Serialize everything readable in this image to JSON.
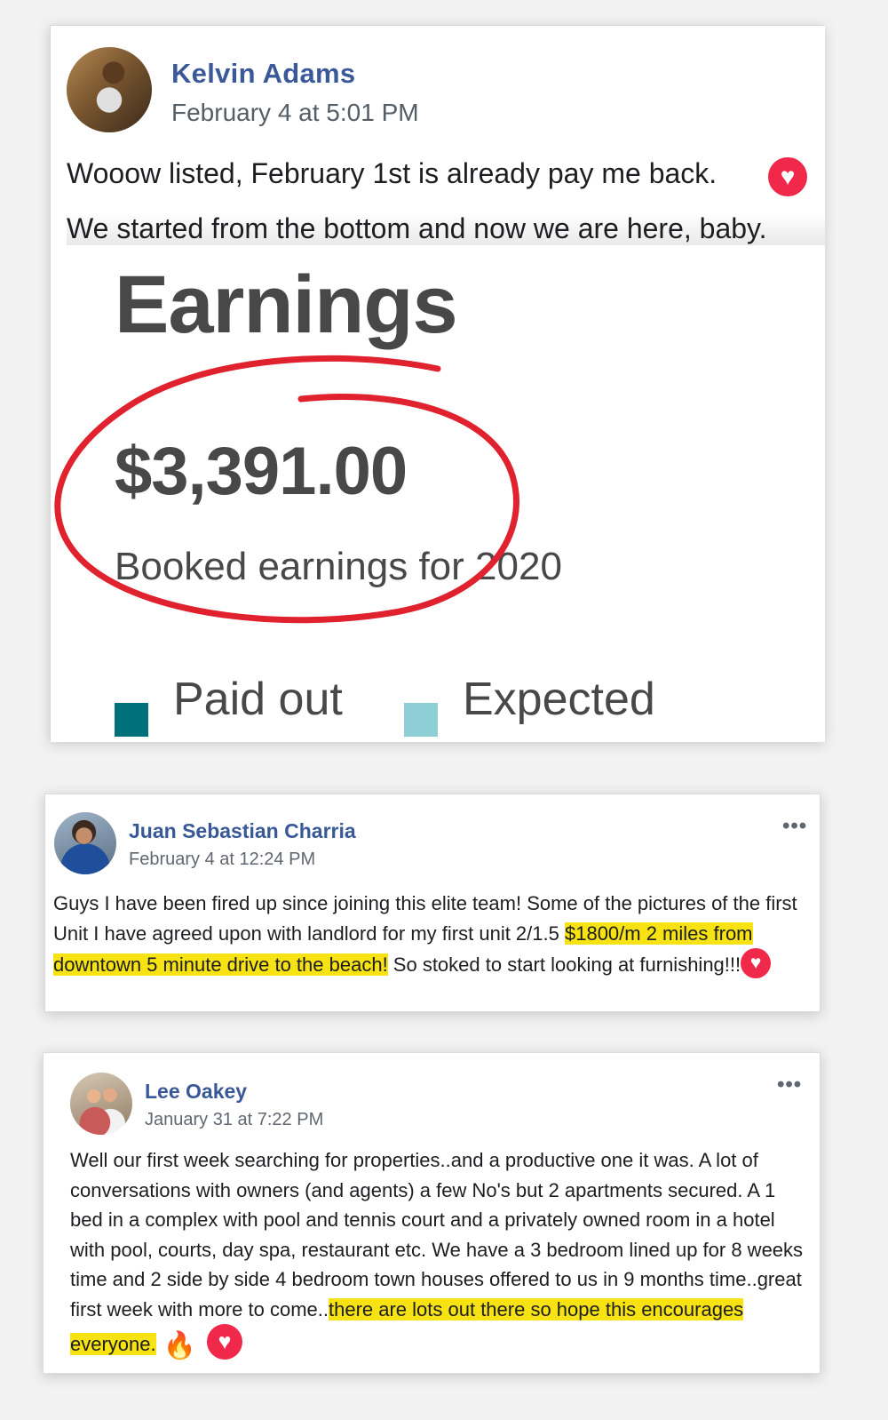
{
  "post1": {
    "author": "Kelvin Adams",
    "timestamp": "February 4 at 5:01 PM",
    "text_line1": "Wooow listed, February 1st is already pay me back.",
    "text_line2": "We started from the bottom and now we are here, baby.",
    "reaction_icon": "heart-icon",
    "screenshot": {
      "title": "Earnings",
      "amount": "$3,391.00",
      "subtitle": "Booked earnings for 2020",
      "annotation": "red hand-drawn circle around amount",
      "legend": [
        {
          "label": "Paid out",
          "color": "#00707a"
        },
        {
          "label": "Expected",
          "color": "#8ecfd6"
        }
      ]
    }
  },
  "post2": {
    "author": "Juan Sebastian Charria",
    "timestamp": "February 4 at 12:24 PM",
    "menu_icon": "more-options-icon",
    "body_pre": "Guys I have been fired up since joining this elite team! Some of the pictures of the first Unit I have agreed upon with landlord for my first unit 2/1.5 ",
    "body_highlight": "$1800/m 2 miles from downtown 5 minute drive to the beach!",
    "body_post": " So stoked to start looking at furnishing!!!",
    "reaction_icon": "heart-icon"
  },
  "post3": {
    "author": "Lee Oakey",
    "timestamp": "January 31 at 7:22 PM",
    "menu_icon": "more-options-icon",
    "body_pre": "Well our first week searching for properties..and a productive one it was. A lot of conversations with owners (and agents) a few No's but 2 apartments secured. A 1 bed in a complex with pool and tennis court and a privately owned room in a hotel with pool, courts, day spa, restaurant etc. We have a 3 bedroom lined up for 8 weeks time and 2 side by side 4 bedroom town houses offered to us in 9 months time..great first week with more to come..",
    "body_highlight": "there are lots out there so hope this encourages everyone.",
    "reaction_icons": [
      "fire-icon",
      "heart-icon"
    ]
  },
  "colors": {
    "link_name": "#3b5998",
    "highlight": "#f7e213",
    "annotation_red": "#e0222e",
    "heart": "#f0284a"
  }
}
